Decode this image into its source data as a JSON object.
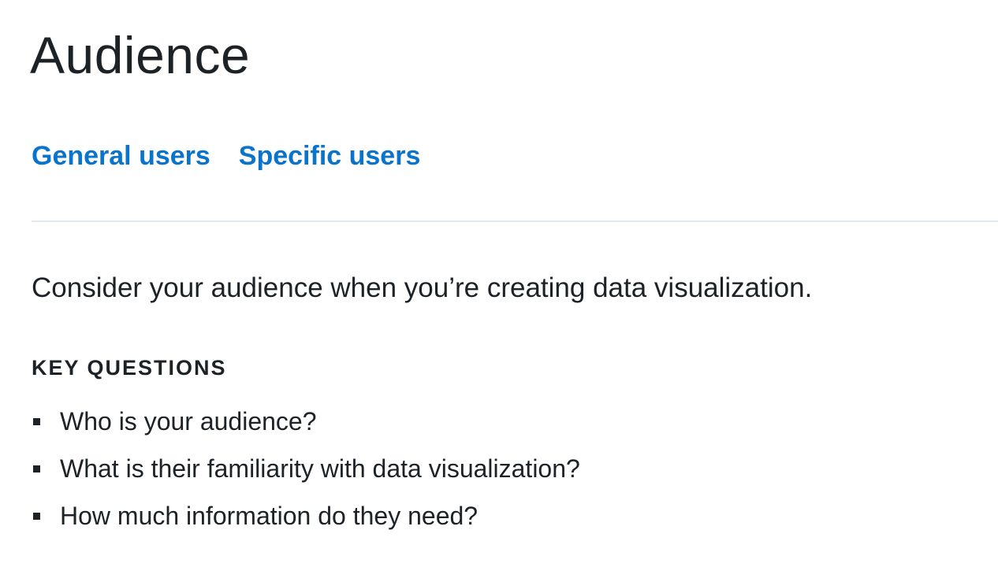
{
  "page": {
    "title": "Audience"
  },
  "tabs": [
    {
      "label": "General users"
    },
    {
      "label": "Specific users"
    }
  ],
  "content": {
    "intro": "Consider your audience when you’re creating data visualization.",
    "section_heading": "KEY QUESTIONS",
    "questions": [
      "Who is your audience?",
      "What is their familiarity with data visualization?",
      "How much information do they need?"
    ]
  },
  "colors": {
    "link": "#0a74cc",
    "text": "#1d2226",
    "divider": "#e3eaef",
    "background": "#ffffff"
  }
}
